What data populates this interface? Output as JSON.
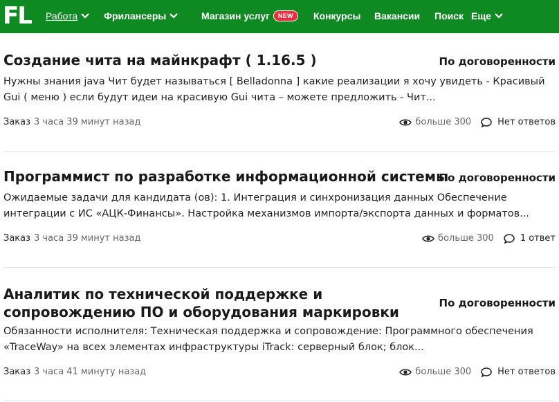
{
  "header": {
    "logo": "FL",
    "nav": [
      {
        "label": "Работа",
        "active": true,
        "dropdown": true
      },
      {
        "label": "Фрилансеры",
        "active": false,
        "dropdown": true
      },
      {
        "label": "Магазин услуг",
        "badge": "NEW"
      },
      {
        "label": "Конкурсы"
      },
      {
        "label": "Вакансии"
      },
      {
        "label": "Поиск"
      },
      {
        "label": "Еще",
        "dropdown": true
      }
    ],
    "colors": {
      "bar": "#0f8a23",
      "badge": "#ea2f3e"
    }
  },
  "jobs": [
    {
      "title": "Создание чита на майнкрафт ( 1.16.5 )",
      "price": "По договоренности",
      "description": "Нужны знания java Чит будет называться [ Belladonna ] какие реализации я хочу увидеть - Красивый Gui ( меню ) если будут идеи на красивую Gui чита – можете предложить - Чит...",
      "type": "Заказ",
      "time": "3 часа 39 минут назад",
      "views": "больше 300",
      "answers": "Нет ответов"
    },
    {
      "title": "Программист по разработке информационной системы",
      "price": "По договоренности",
      "description": "Ожидаемые задачи для кандидата (ов): 1. Интеграция и синхронизация данных Обеспечение интеграции с ИС «АЦК-Финансы». Настройка механизмов импорта/экспорта данных и форматов...",
      "type": "Заказ",
      "time": "3 часа 39 минут назад",
      "views": "больше 300",
      "answers": "1 ответ"
    },
    {
      "title": "Аналитик по технической поддержке и сопровождению ПО и оборудования маркировки",
      "price": "По договоренности",
      "description": "Обязанности исполнителя: Техническая поддержка и сопровождение: Программного обеспечения «TraceWay» на всех элементах инфраструктуры iTrack: серверный блок; блок...",
      "type": "Заказ",
      "time": "3 часа 41 минуту назад",
      "views": "больше 300",
      "answers": "Нет ответов"
    }
  ]
}
